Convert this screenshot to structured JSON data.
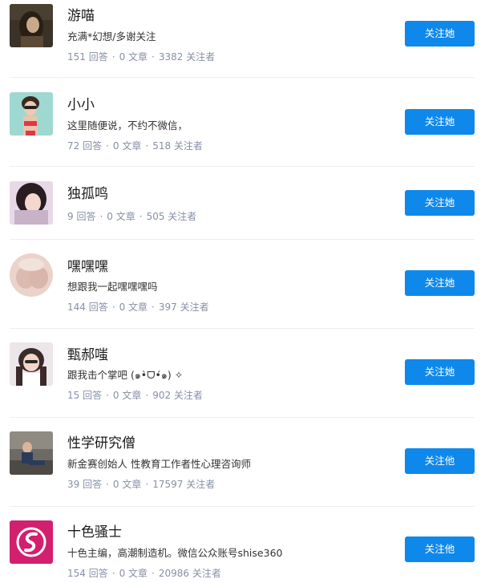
{
  "users": [
    {
      "name": "游喵",
      "bio": "充满*幻想/多谢关注",
      "answers": "151 回答",
      "articles": "0 文章",
      "followers": "3382 关注者",
      "follow_label": "关注她"
    },
    {
      "name": "小小",
      "bio": "这里随便说，不约不微信，",
      "answers": "72 回答",
      "articles": "0 文章",
      "followers": "518 关注者",
      "follow_label": "关注她"
    },
    {
      "name": "独孤鸣",
      "bio": "",
      "answers": "9 回答",
      "articles": "0 文章",
      "followers": "505 关注者",
      "follow_label": "关注她"
    },
    {
      "name": "嘿嘿嘿",
      "bio": "想跟我一起嘿嘿嘿吗",
      "answers": "144 回答",
      "articles": "0 文章",
      "followers": "397 关注者",
      "follow_label": "关注她"
    },
    {
      "name": "甄郝嗤",
      "bio": "跟我击个掌吧 (๑•̀ᗜ•́๑) ✧",
      "answers": "15 回答",
      "articles": "0 文章",
      "followers": "902 关注者",
      "follow_label": "关注她"
    },
    {
      "name": "性学研究僧",
      "bio": "新金赛创始人 性教育工作者性心理咨询师",
      "answers": "39 回答",
      "articles": "0 文章",
      "followers": "17597 关注者",
      "follow_label": "关注他"
    },
    {
      "name": "十色骚士",
      "bio": "十色主编，高潮制造机。微信公众账号shise360",
      "answers": "154 回答",
      "articles": "0 文章",
      "followers": "20986 关注者",
      "follow_label": "关注他"
    }
  ],
  "separator": "·",
  "colors": {
    "accent": "#0f88eb",
    "stats": "#8590a6",
    "name": "#1a1a1a"
  }
}
